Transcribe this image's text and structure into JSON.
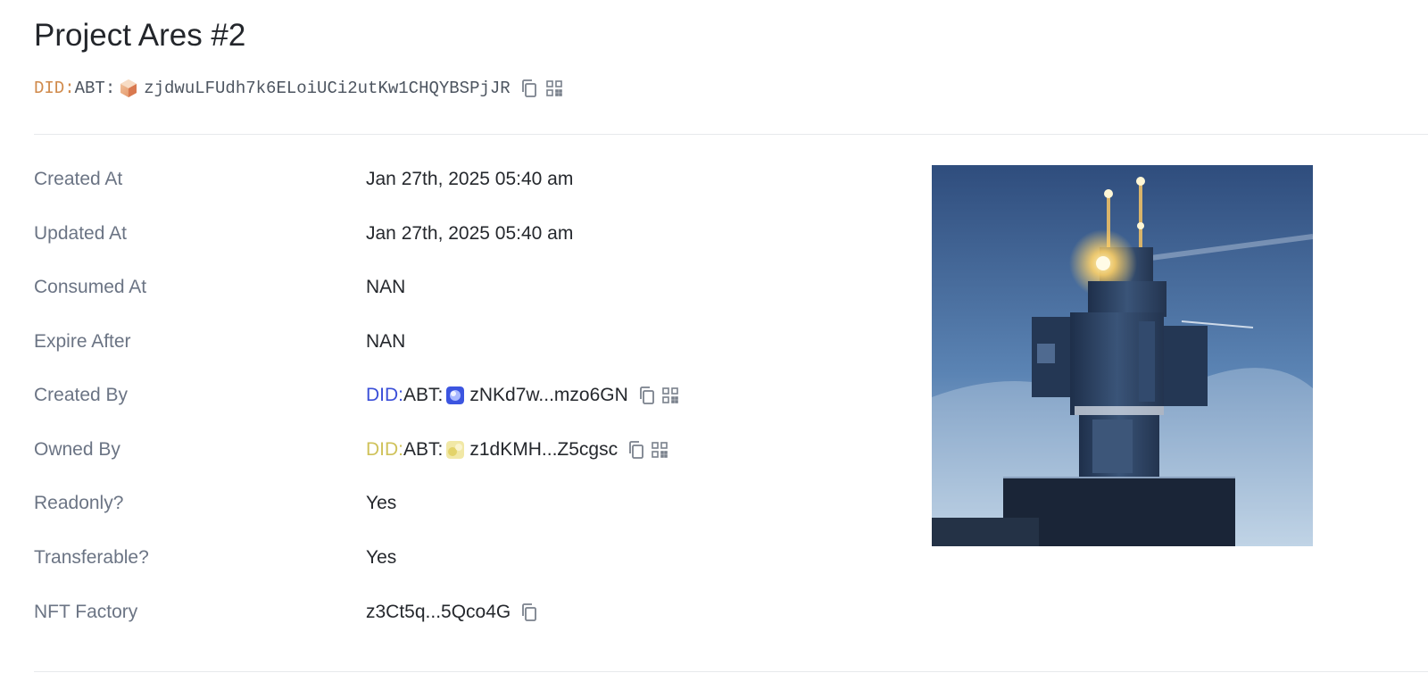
{
  "page": {
    "title": "Project Ares #2",
    "did": {
      "prefix": "DID:",
      "method": "ABT:",
      "address": "zjdwuLFUdh7k6ELoiUCi2utKw1CHQYBSPjJR"
    }
  },
  "details": [
    {
      "label": "Created At",
      "value": "Jan 27th, 2025 05:40 am"
    },
    {
      "label": "Updated At",
      "value": "Jan 27th, 2025 05:40 am"
    },
    {
      "label": "Consumed At",
      "value": "NAN"
    },
    {
      "label": "Expire After",
      "value": "NAN"
    },
    {
      "label": "Created By",
      "did_prefix": "DID",
      "did_sep": ":",
      "did_method": "ABT:",
      "address": "zNKd7w...mzo6GN",
      "prefix_color": "#3b4fd8"
    },
    {
      "label": "Owned By",
      "did_prefix": "DID",
      "did_sep": ":",
      "did_method": "ABT:",
      "address": "z1dKMH...Z5cgsc",
      "prefix_color": "#cfc25a"
    },
    {
      "label": "Readonly?",
      "value": "Yes"
    },
    {
      "label": "Transferable?",
      "value": "Yes"
    },
    {
      "label": "NFT Factory",
      "value": "z3Ct5q...5Qco4G"
    }
  ],
  "colors": {
    "title_did_prefix": "#d08a4b",
    "label": "#6b7484",
    "value": "#25282d",
    "divider": "#e7e9ec"
  },
  "icons": {
    "copy": "copy-icon",
    "qrcode": "qrcode-icon"
  }
}
